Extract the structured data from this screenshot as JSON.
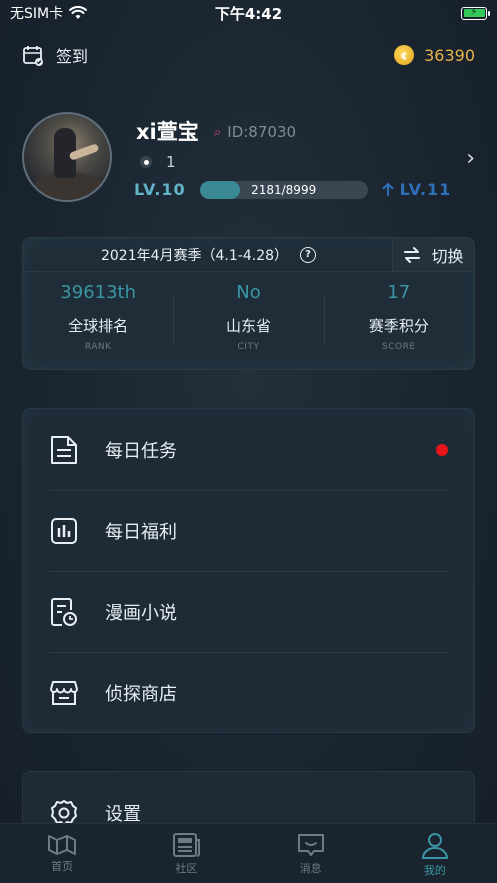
{
  "status_bar": {
    "carrier": "无SIM卡",
    "time": "下午4:42",
    "icons": [
      "wifi-icon",
      "battery-charging-icon"
    ]
  },
  "header": {
    "checkin_label": "签到",
    "coins": "36390",
    "icons": [
      "calendar-check-icon",
      "coin-icon"
    ]
  },
  "profile": {
    "name": "xi萱宝",
    "id": "ID:87030",
    "follow_count": "1",
    "level_current": "LV.10",
    "exp_text": "2181/8999",
    "exp_fraction": 0.2424,
    "level_next": "LV.11",
    "icons": [
      "avatar",
      "id-icon",
      "dot-icon",
      "chevron-right-icon",
      "arrow-up-icon"
    ]
  },
  "season": {
    "title": "2021年4月赛季（4.1-4.28）",
    "switch_label": "切换",
    "stats": [
      {
        "value": "39613th",
        "label": "全球排名",
        "sub": "RANK"
      },
      {
        "value": "No",
        "label": "山东省",
        "sub": "CITY"
      },
      {
        "value": "17",
        "label": "赛季积分",
        "sub": "SCORE"
      }
    ],
    "icons": [
      "help-icon",
      "switch-icon"
    ]
  },
  "menu": {
    "items": [
      {
        "label": "每日任务",
        "icon": "document-icon",
        "badge": true
      },
      {
        "label": "每日福利",
        "icon": "bar-chart-icon",
        "badge": false
      },
      {
        "label": "漫画小说",
        "icon": "book-clock-icon",
        "badge": false
      },
      {
        "label": "侦探商店",
        "icon": "store-icon",
        "badge": false
      }
    ]
  },
  "settings": {
    "label": "设置",
    "icon": "gear-icon"
  },
  "tabbar": {
    "tabs": [
      {
        "label": "首页",
        "icon": "map-icon",
        "active": false
      },
      {
        "label": "社区",
        "icon": "newspaper-icon",
        "active": false
      },
      {
        "label": "消息",
        "icon": "chat-icon",
        "active": false
      },
      {
        "label": "我的",
        "icon": "user-icon",
        "active": true
      }
    ]
  },
  "colors": {
    "background": "#1b2631",
    "accent": "#3a96a4",
    "level_next": "#2f6fb8",
    "coin": "#e8b34a",
    "badge": "#e8161b"
  }
}
